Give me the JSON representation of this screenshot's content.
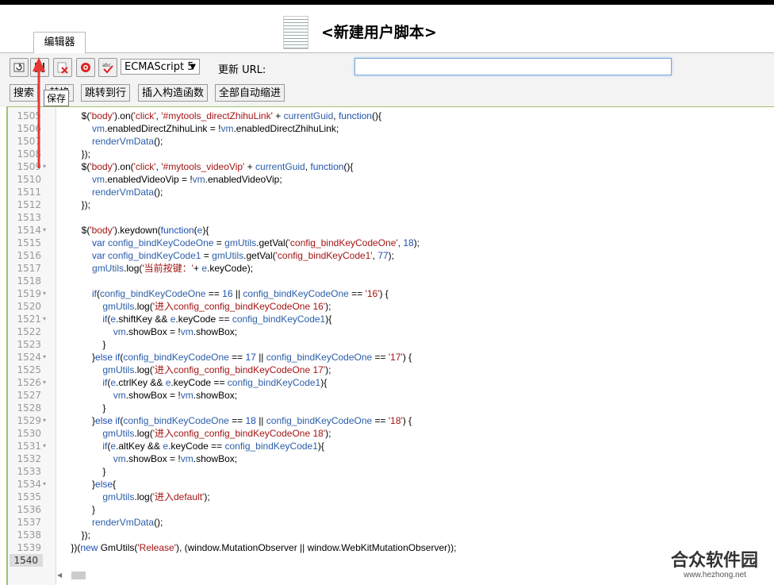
{
  "header": {
    "title": "<新建用户脚本>",
    "tab": "编辑器"
  },
  "toolbar": {
    "icons": [
      "reload-icon",
      "save-icon",
      "close-red-icon",
      "record-icon",
      "spellcheck-icon"
    ],
    "language": "ECMAScript 5",
    "url_label": "更新 URL:",
    "url_value": ""
  },
  "buttons": {
    "search": "搜索",
    "replace": "替换",
    "goto": "跳转到行",
    "insert_ctor": "插入构造函数",
    "autoindent": "全部自动缩进"
  },
  "tooltip": "保存",
  "gutter": {
    "lines": [
      "1505",
      "1506",
      "1507",
      "1508",
      "1509",
      "1510",
      "1511",
      "1512",
      "1513",
      "1514",
      "1515",
      "1516",
      "1517",
      "1518",
      "1519",
      "1520",
      "1521",
      "1522",
      "1523",
      "1524",
      "1525",
      "1526",
      "1527",
      "1528",
      "1529",
      "1530",
      "1531",
      "1532",
      "1533",
      "1534",
      "1535",
      "1536",
      "1537",
      "1538",
      "1539",
      "1540"
    ]
  },
  "code_lines": [
    "        $('body').on('click', '#mytools_directZhihuLink' + currentGuid, function(){",
    "            vm.enabledDirectZhihuLink = !vm.enabledDirectZhihuLink;",
    "            renderVmData();",
    "        });",
    "        $('body').on('click', '#mytools_videoVip' + currentGuid, function(){",
    "            vm.enabledVideoVip = !vm.enabledVideoVip;",
    "            renderVmData();",
    "        });",
    "",
    "        $('body').keydown(function(e){",
    "            var config_bindKeyCodeOne = gmUtils.getVal('config_bindKeyCodeOne', 18);",
    "            var config_bindKeyCode1 = gmUtils.getVal('config_bindKeyCode1', 77);",
    "            gmUtils.log('当前按键：'+ e.keyCode);",
    "",
    "            if(config_bindKeyCodeOne == 16 || config_bindKeyCodeOne == '16') {",
    "                gmUtils.log('进入config_config_bindKeyCodeOne 16');",
    "                if(e.shiftKey && e.keyCode == config_bindKeyCode1){",
    "                    vm.showBox = !vm.showBox;",
    "                }",
    "            }else if(config_bindKeyCodeOne == 17 || config_bindKeyCodeOne == '17') {",
    "                gmUtils.log('进入config_config_bindKeyCodeOne 17');",
    "                if(e.ctrlKey && e.keyCode == config_bindKeyCode1){",
    "                    vm.showBox = !vm.showBox;",
    "                }",
    "            }else if(config_bindKeyCodeOne == 18 || config_bindKeyCodeOne == '18') {",
    "                gmUtils.log('进入config_config_bindKeyCodeOne 18');",
    "                if(e.altKey && e.keyCode == config_bindKeyCode1){",
    "                    vm.showBox = !vm.showBox;",
    "                }",
    "            }else{",
    "                gmUtils.log('进入default');",
    "            }",
    "            renderVmData();",
    "        });",
    "    })(new GmUtils('Release'), (window.MutationObserver || window.WebKitMutationObserver));",
    ""
  ],
  "watermark": {
    "main": "合众软件园",
    "sub": "www.hezhong.net"
  },
  "colors": {
    "editor_border": "#9ec36f",
    "annotation_arrow": "#e53935",
    "url_focus": "#7aa8d8"
  }
}
